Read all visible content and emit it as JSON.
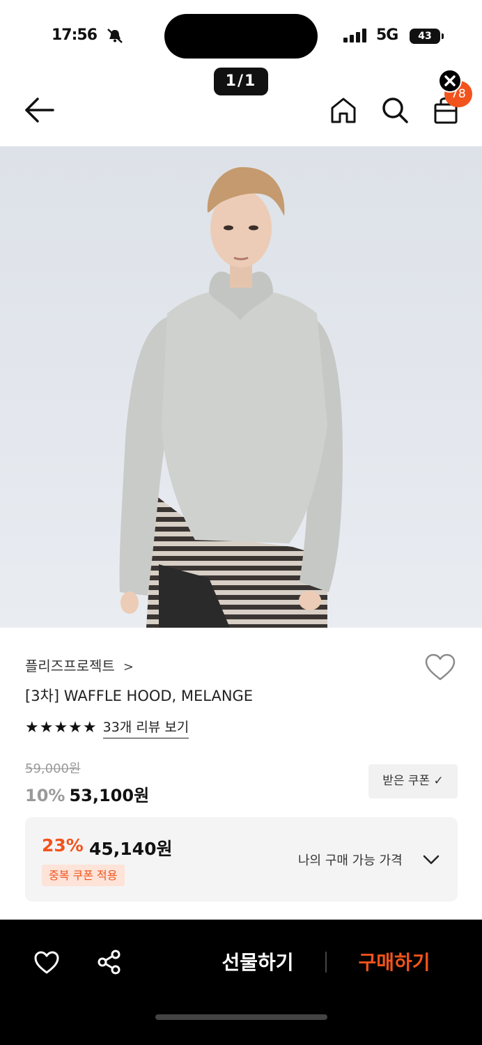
{
  "status_bar": {
    "time": "17:56",
    "network": "5G",
    "battery": "43"
  },
  "page_counter": "1/1",
  "header": {
    "cart_count": "78"
  },
  "product": {
    "brand": "플리즈프로젝트",
    "brand_chevron": ">",
    "title": "[3차] WAFFLE HOOD, MELANGE",
    "stars": "★★★★★",
    "rating": 5,
    "review_link": "33개 리뷰 보기",
    "original_price": "59,000원",
    "discount_rate": "10%",
    "sale_price": "53,100원",
    "coupon_button": "받은 쿠폰 ✓"
  },
  "benefit": {
    "rate": "23%",
    "price": "45,140원",
    "tag": "중복 쿠폰 적용",
    "toggle_label": "나의 구매 가능 가격"
  },
  "bottom_bar": {
    "gift_label": "선물하기",
    "buy_label": "구매하기"
  },
  "colors": {
    "accent": "#f2531c",
    "background": "#ffffff",
    "bottom_bar": "#000000",
    "benefit_box": "#f4f4f4"
  }
}
